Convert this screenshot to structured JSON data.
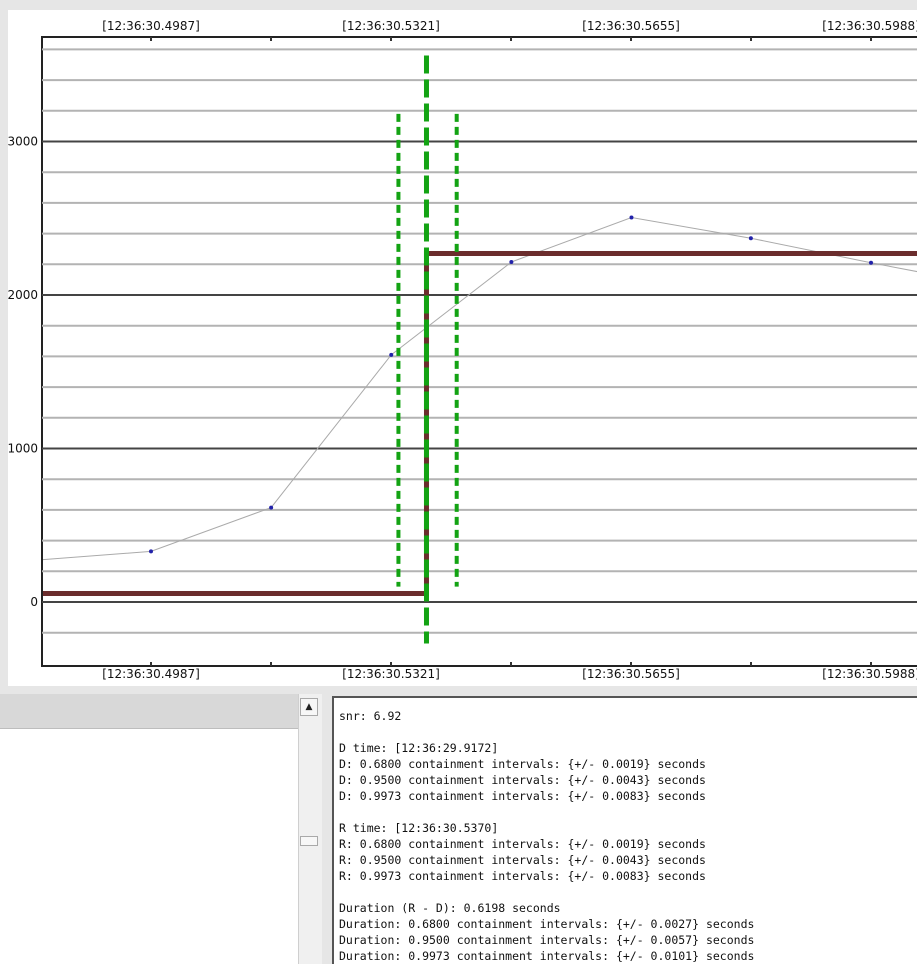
{
  "chart_data": {
    "type": "line",
    "x_tick_labels": [
      "[12:36:30.4987]",
      "[12:36:30.5321]",
      "[12:36:30.5655]",
      "[12:36:30.5988]"
    ],
    "y_tick_labels": [
      "0",
      "1000",
      "2000",
      "3000"
    ],
    "ylim": [
      -200,
      3600
    ],
    "xlim_seconds": [
      30.4987,
      30.5988
    ],
    "grid": true,
    "series": [
      {
        "style": "thin gray line with blue dot markers",
        "color": "#aaaaaa",
        "marker_color": "#2222aa",
        "points": [
          {
            "x": 30.4654,
            "y": 210
          },
          {
            "x": 30.4987,
            "y": 330
          },
          {
            "x": 30.5154,
            "y": 615
          },
          {
            "x": 30.5321,
            "y": 1610
          },
          {
            "x": 30.5488,
            "y": 2215
          },
          {
            "x": 30.5655,
            "y": 2505
          },
          {
            "x": 30.5821,
            "y": 2370
          },
          {
            "x": 30.5988,
            "y": 2210
          },
          {
            "x": 30.6055,
            "y": 2150
          }
        ]
      },
      {
        "style": "thick dark red step",
        "color": "#6b2d2d",
        "step_x": 30.537,
        "level_before": 55,
        "level_after": 2270
      }
    ],
    "vertical_markers": [
      {
        "x": 30.537,
        "y_range": [
          -270,
          3560
        ],
        "style": "long dash",
        "color": "#13a313"
      },
      {
        "x": 30.5331,
        "y_range": [
          100,
          3180
        ],
        "style": "short dash",
        "color": "#13a313"
      },
      {
        "x": 30.5412,
        "y_range": [
          100,
          3180
        ],
        "style": "short dash",
        "color": "#13a313"
      }
    ]
  },
  "left_panel": {
    "scroll_up_icon": "▲"
  },
  "report": {
    "lines": [
      "snr: 6.92",
      "",
      "D time: [12:36:29.9172]",
      "D: 0.6800 containment intervals: {+/- 0.0019} seconds",
      "D: 0.9500 containment intervals: {+/- 0.0043} seconds",
      "D: 0.9973 containment intervals: {+/- 0.0083} seconds",
      "",
      "R time: [12:36:30.5370]",
      "R: 0.6800 containment intervals: {+/- 0.0019} seconds",
      "R: 0.9500 containment intervals: {+/- 0.0043} seconds",
      "R: 0.9973 containment intervals: {+/- 0.0083} seconds",
      "",
      "Duration (R - D): 0.6198 seconds",
      "Duration: 0.6800 containment intervals: {+/- 0.0027} seconds",
      "Duration: 0.9500 containment intervals: {+/- 0.0057} seconds",
      "Duration: 0.9973 containment intervals: {+/- 0.0101} seconds"
    ]
  }
}
